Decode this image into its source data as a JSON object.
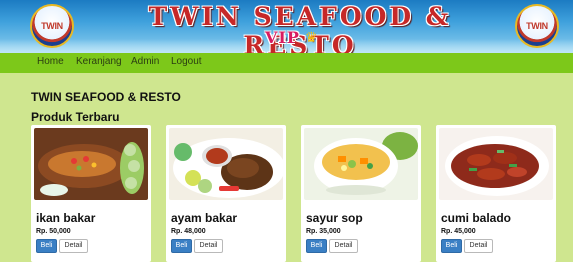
{
  "banner": {
    "title": "TWIN SEAFOOD & RESTO",
    "subtitle": "VIP",
    "logo_text": "TWIN"
  },
  "nav": {
    "items": [
      "Home",
      "Keranjang",
      "Admin",
      "Logout"
    ]
  },
  "page": {
    "store_title": "TWIN SEAFOOD & RESTO",
    "section_title": "Produk Terbaru"
  },
  "products": [
    {
      "name": "ikan bakar",
      "price": "Rp. 50,000",
      "buy_label": "Beli",
      "detail_label": "Detail"
    },
    {
      "name": "ayam bakar",
      "price": "Rp. 48,000",
      "buy_label": "Beli",
      "detail_label": "Detail"
    },
    {
      "name": "sayur sop",
      "price": "Rp. 35,000",
      "buy_label": "Beli",
      "detail_label": "Detail"
    },
    {
      "name": "cumi balado",
      "price": "Rp. 45,000",
      "buy_label": "Beli",
      "detail_label": "Detail"
    }
  ],
  "colors": {
    "page_bg": "#cfe68f",
    "navbar_bg": "#7dc81a",
    "banner_blue": "#1c7bc2",
    "title_red": "#c62828",
    "buy_button": "#3a7fc4"
  },
  "icons": {
    "crown": "crown-icon",
    "logo": "twin-logo"
  }
}
